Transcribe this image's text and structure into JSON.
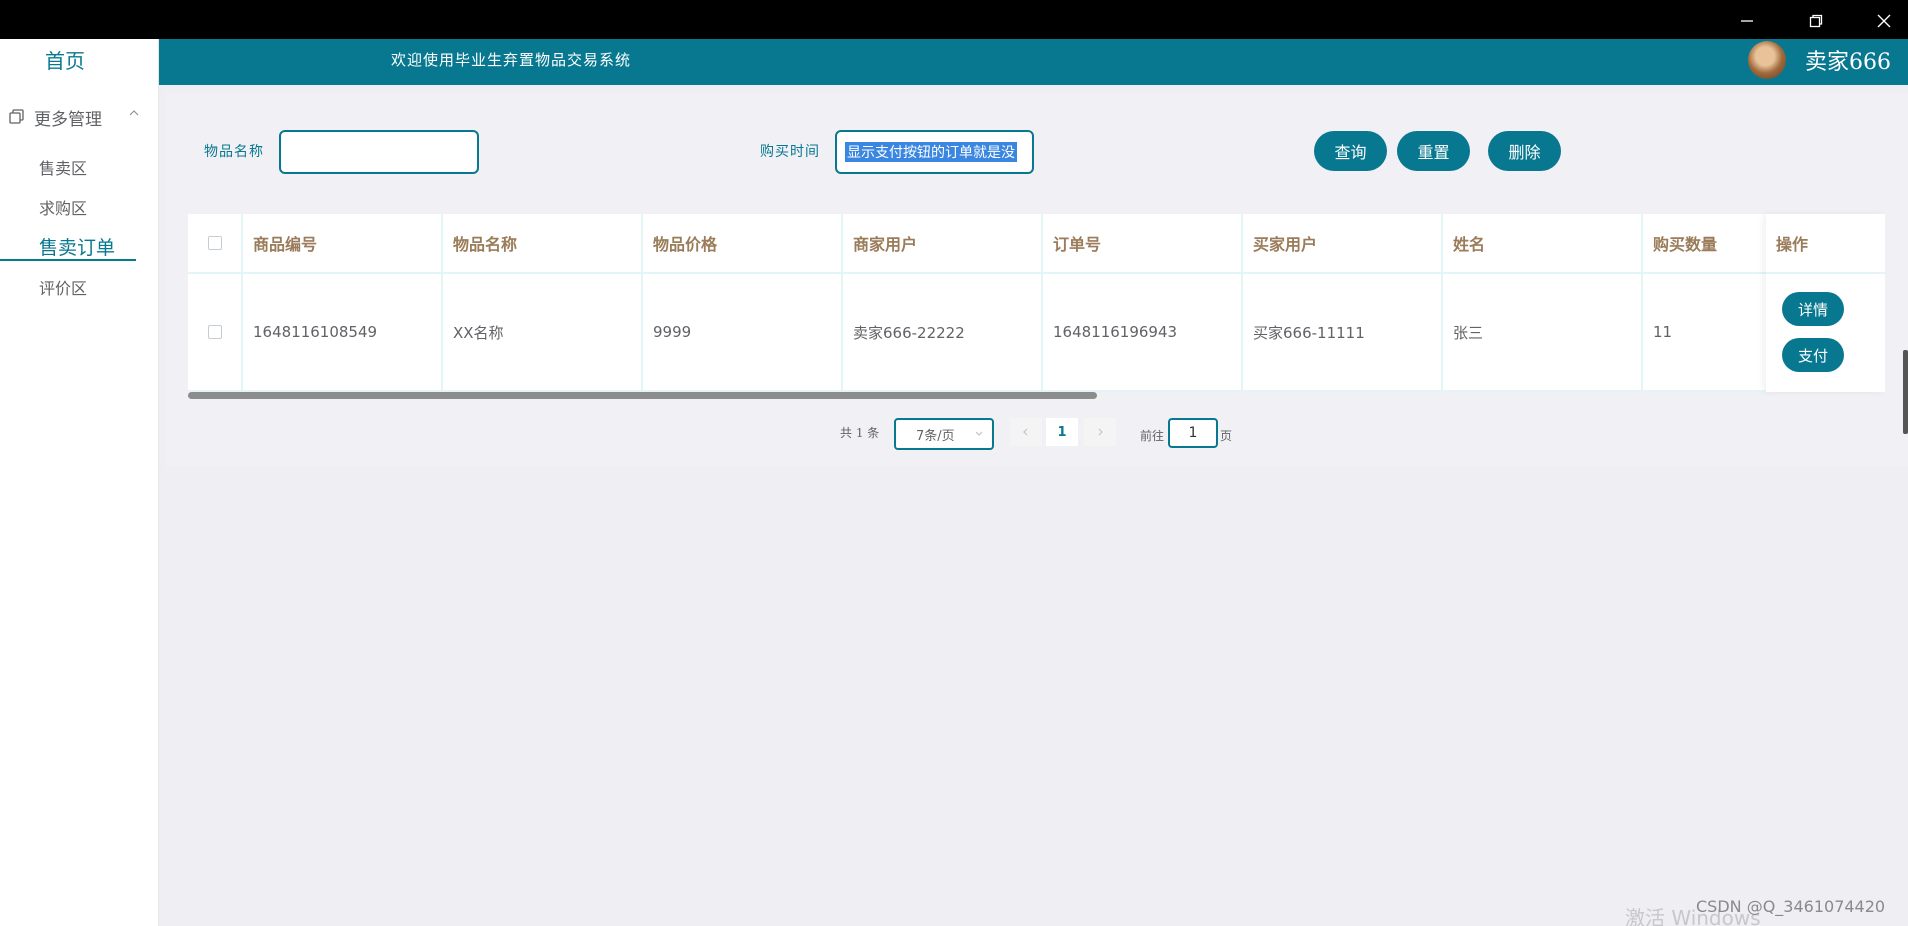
{
  "header": {
    "title": "欢迎使用毕业生弃置物品交易系统",
    "username": "卖家666"
  },
  "sidebar": {
    "home": "首页",
    "group": "更多管理",
    "items": [
      {
        "label": "售卖区"
      },
      {
        "label": "求购区"
      },
      {
        "label": "售卖订单"
      },
      {
        "label": "评价区"
      }
    ]
  },
  "search": {
    "name_label": "物品名称",
    "name_value": "",
    "time_label": "购买时间",
    "time_value": "显示支付按钮的订单就是没"
  },
  "buttons": {
    "query": "查询",
    "reset": "重置",
    "delete": "删除"
  },
  "table": {
    "columns": [
      "商品编号",
      "物品名称",
      "物品价格",
      "商家用户",
      "订单号",
      "买家用户",
      "姓名",
      "购买数量",
      "操作"
    ],
    "rows": [
      {
        "product_id": "1648116108549",
        "name": "XX名称",
        "price": "9999",
        "merchant": "卖家666-22222",
        "order_no": "1648116196943",
        "buyer": "买家666-11111",
        "buyer_name": "张三",
        "quantity": "11",
        "actions": [
          "详情",
          "支付"
        ]
      }
    ]
  },
  "pagination": {
    "total": "共 1 条",
    "page_size": "7条/页",
    "current": "1",
    "goto_label": "前往",
    "goto_value": "1",
    "page_suffix": "页"
  },
  "watermark": {
    "windows": "激活 Windows",
    "csdn": "CSDN @Q_3461074420"
  },
  "colors": {
    "primary": "#087890",
    "header_text": "#9a7c5a",
    "background": "#eeeef3"
  }
}
